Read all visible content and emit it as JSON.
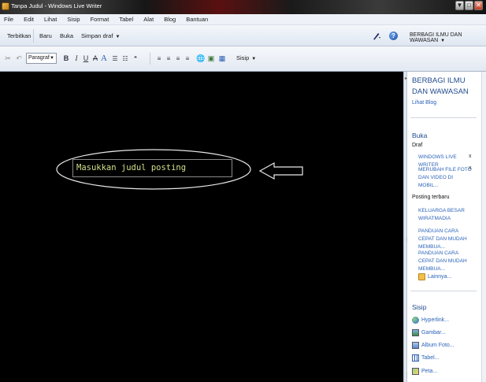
{
  "window": {
    "title": "Tanpa Judul - Windows Live Writer",
    "controls": [
      "▼",
      "□",
      "✕"
    ]
  },
  "menu": [
    "File",
    "Edit",
    "Lihat",
    "Sisip",
    "Format",
    "Tabel",
    "Alat",
    "Blog",
    "Bantuan"
  ],
  "commandbar": {
    "publish": "Terbitkan",
    "new": "Baru",
    "open": "Buka",
    "save_draft": "Simpan draf",
    "blog_selector": "BERBAGI ILMU DAN WAWASAN"
  },
  "format_toolbar": {
    "paragraph_style": "Paragraf",
    "bold": "B",
    "italic": "I",
    "underline": "U",
    "strikethrough": "A",
    "font_color": "A",
    "insert": "Sisip"
  },
  "editor": {
    "title_placeholder": "Masukkan judul posting"
  },
  "sidebar": {
    "blog_name": "BERBAGI ILMU DAN WAWASAN",
    "view_blog": "Lihat Blog",
    "open_header": "Buka",
    "drafts_header": "Draf",
    "drafts": [
      {
        "title": "WINDOWS LIVE WRITER",
        "remove": "x"
      },
      {
        "title": "MERUBAH FILE FOTO DAN VIDEO DI MOBIL...",
        "remove": "x"
      }
    ],
    "recent_header": "Posting terbaru",
    "recent_posts": [
      "KELUARGA BESAR WIRATMADIA",
      "PANDUAN CARA CEPAT DAN MUDAH MEMBUA...",
      "PANDUAN CARA CEPAT DAN MUDAH MEMBUA..."
    ],
    "more": "Lainnya...",
    "insert_header": "Sisip",
    "insert_items": [
      "Hyperlink...",
      "Gambar...",
      "Album Foto...",
      "Tabel...",
      "Peta..."
    ]
  },
  "colors": {
    "editor_bg": "#000000",
    "title_text": "#cfe08a",
    "link": "#2a63b8",
    "heading": "#1f4a8c"
  }
}
